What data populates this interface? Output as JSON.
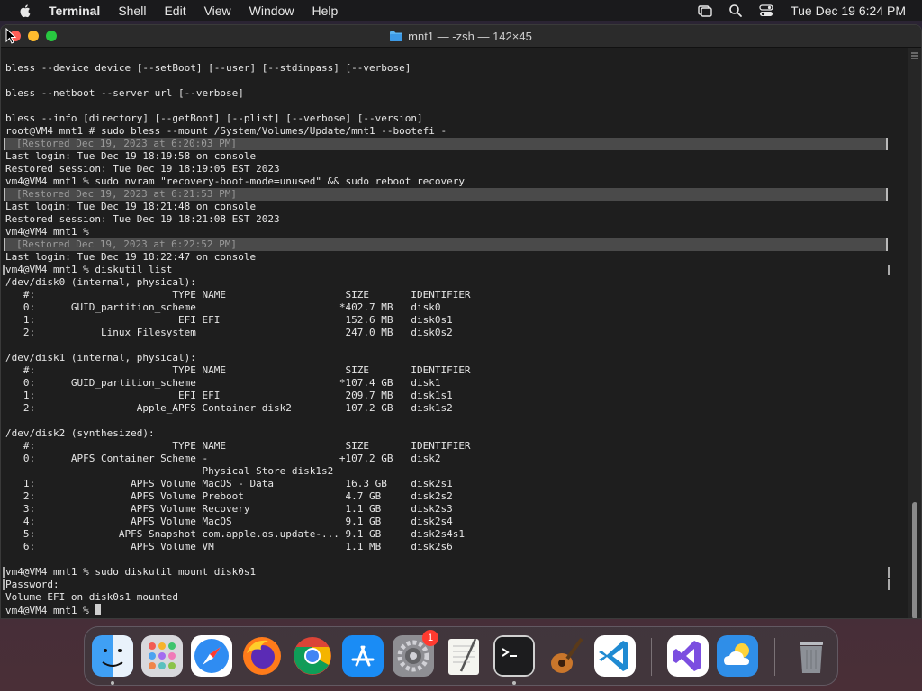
{
  "menubar": {
    "app_name": "Terminal",
    "items": [
      "Shell",
      "Edit",
      "View",
      "Window",
      "Help"
    ],
    "clock": "Tue Dec 19  6:24 PM"
  },
  "window": {
    "title": "mnt1 — -zsh — 142×45"
  },
  "terminal": {
    "lines": [
      {
        "text": "",
        "style": "normal"
      },
      {
        "text": "bless --device device [--setBoot] [--user] [--stdinpass] [--verbose]",
        "style": "normal"
      },
      {
        "text": "",
        "style": "normal"
      },
      {
        "text": "bless --netboot --server url [--verbose]",
        "style": "normal"
      },
      {
        "text": "",
        "style": "normal"
      },
      {
        "text": "bless --info [directory] [--getBoot] [--plist] [--verbose] [--version]",
        "style": "normal"
      },
      {
        "text": "root@VM4 mnt1 # sudo bless --mount /System/Volumes/Update/mnt1 --bootefi -",
        "style": "normal"
      },
      {
        "text": "[Restored Dec 19, 2023 at 6:20:03 PM]",
        "style": "restored"
      },
      {
        "text": "Last login: Tue Dec 19 18:19:58 on console",
        "style": "normal"
      },
      {
        "text": "Restored session: Tue Dec 19 18:19:05 EST 2023",
        "style": "normal"
      },
      {
        "text": "vm4@VM4 mnt1 % sudo nvram \"recovery-boot-mode=unused\" && sudo reboot recovery",
        "style": "normal"
      },
      {
        "text": "[Restored Dec 19, 2023 at 6:21:53 PM]",
        "style": "restored"
      },
      {
        "text": "Last login: Tue Dec 19 18:21:48 on console",
        "style": "normal"
      },
      {
        "text": "Restored session: Tue Dec 19 18:21:08 EST 2023",
        "style": "normal"
      },
      {
        "text": "vm4@VM4 mnt1 %",
        "style": "normal"
      },
      {
        "text": "[Restored Dec 19, 2023 at 6:22:52 PM]",
        "style": "restored"
      },
      {
        "text": "Last login: Tue Dec 19 18:22:47 on console",
        "style": "normal"
      },
      {
        "text": "vm4@VM4 mnt1 % diskutil list",
        "style": "bracketed"
      },
      {
        "text": "/dev/disk0 (internal, physical):",
        "style": "normal"
      },
      {
        "text": "   #:                       TYPE NAME                    SIZE       IDENTIFIER",
        "style": "normal"
      },
      {
        "text": "   0:      GUID_partition_scheme                        *402.7 MB   disk0",
        "style": "normal"
      },
      {
        "text": "   1:                        EFI EFI                     152.6 MB   disk0s1",
        "style": "normal"
      },
      {
        "text": "   2:           Linux Filesystem                         247.0 MB   disk0s2",
        "style": "normal"
      },
      {
        "text": "",
        "style": "normal"
      },
      {
        "text": "/dev/disk1 (internal, physical):",
        "style": "normal"
      },
      {
        "text": "   #:                       TYPE NAME                    SIZE       IDENTIFIER",
        "style": "normal"
      },
      {
        "text": "   0:      GUID_partition_scheme                        *107.4 GB   disk1",
        "style": "normal"
      },
      {
        "text": "   1:                        EFI EFI                     209.7 MB   disk1s1",
        "style": "normal"
      },
      {
        "text": "   2:                 Apple_APFS Container disk2         107.2 GB   disk1s2",
        "style": "normal"
      },
      {
        "text": "",
        "style": "normal"
      },
      {
        "text": "/dev/disk2 (synthesized):",
        "style": "normal"
      },
      {
        "text": "   #:                       TYPE NAME                    SIZE       IDENTIFIER",
        "style": "normal"
      },
      {
        "text": "   0:      APFS Container Scheme -                      +107.2 GB   disk2",
        "style": "normal"
      },
      {
        "text": "                                 Physical Store disk1s2",
        "style": "normal"
      },
      {
        "text": "   1:                APFS Volume MacOS - Data            16.3 GB    disk2s1",
        "style": "normal"
      },
      {
        "text": "   2:                APFS Volume Preboot                 4.7 GB     disk2s2",
        "style": "normal"
      },
      {
        "text": "   3:                APFS Volume Recovery                1.1 GB     disk2s3",
        "style": "normal"
      },
      {
        "text": "   4:                APFS Volume MacOS                   9.1 GB     disk2s4",
        "style": "normal"
      },
      {
        "text": "   5:              APFS Snapshot com.apple.os.update-... 9.1 GB     disk2s4s1",
        "style": "normal"
      },
      {
        "text": "   6:                APFS Volume VM                      1.1 MB     disk2s6",
        "style": "normal"
      },
      {
        "text": "",
        "style": "normal"
      },
      {
        "text": "vm4@VM4 mnt1 % sudo diskutil mount disk0s1",
        "style": "bracketed"
      },
      {
        "text": "Password:",
        "style": "bracketed"
      },
      {
        "text": "Volume EFI on disk0s1 mounted",
        "style": "normal"
      },
      {
        "text": "vm4@VM4 mnt1 % ",
        "style": "prompt"
      }
    ]
  },
  "dock": {
    "settings_badge": "1"
  },
  "colors": {
    "terminal_bg": "#1e1e1e",
    "terminal_fg": "#e6e6e6",
    "restored_bg": "#4a4a4a"
  }
}
